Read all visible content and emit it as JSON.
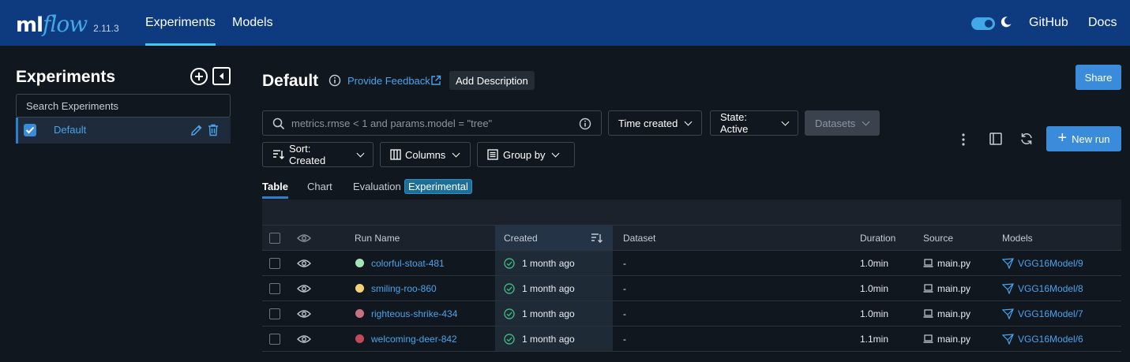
{
  "nav": {
    "logo_ml": "ml",
    "logo_flow": "flow",
    "version": "2.11.3",
    "items": [
      {
        "label": "Experiments",
        "active": true
      },
      {
        "label": "Models",
        "active": false
      }
    ],
    "github": "GitHub",
    "docs": "Docs"
  },
  "sidebar": {
    "title": "Experiments",
    "search_placeholder": "Search Experiments",
    "experiments": [
      {
        "name": "Default",
        "checked": true
      }
    ]
  },
  "header": {
    "title": "Default",
    "feedback_label": "Provide Feedback",
    "add_description_label": "Add Description",
    "share_label": "Share"
  },
  "filters": {
    "search_placeholder": "metrics.rmse < 1 and params.model = \"tree\"",
    "time_created": "Time created",
    "state": "State: Active",
    "datasets": "Datasets",
    "sort": "Sort: Created",
    "columns": "Columns",
    "group_by": "Group by",
    "new_run": "New run"
  },
  "tabs": [
    {
      "label": "Table",
      "active": true
    },
    {
      "label": "Chart",
      "active": false
    },
    {
      "label": "Evaluation",
      "active": false,
      "tag": "Experimental"
    }
  ],
  "table": {
    "headers": {
      "run_name": "Run Name",
      "created": "Created",
      "dataset": "Dataset",
      "duration": "Duration",
      "source": "Source",
      "models": "Models"
    },
    "rows": [
      {
        "run_name": "colorful-stoat-481",
        "color": "#a6e3b8",
        "created": "1 month ago",
        "dataset": "-",
        "duration": "1.0min",
        "source": "main.py",
        "model": "VGG16Model/9"
      },
      {
        "run_name": "smiling-roo-860",
        "color": "#f5d27a",
        "created": "1 month ago",
        "dataset": "-",
        "duration": "1.0min",
        "source": "main.py",
        "model": "VGG16Model/8"
      },
      {
        "run_name": "righteous-shrike-434",
        "color": "#c9727f",
        "created": "1 month ago",
        "dataset": "-",
        "duration": "1.0min",
        "source": "main.py",
        "model": "VGG16Model/7"
      },
      {
        "run_name": "welcoming-deer-842",
        "color": "#c14a5a",
        "created": "1 month ago",
        "dataset": "-",
        "duration": "1.1min",
        "source": "main.py",
        "model": "VGG16Model/6"
      }
    ]
  },
  "colors": {
    "topbar": "#0e3b80",
    "accent": "#3a8bd9",
    "link": "#4aa3ec",
    "success": "#3fb27f"
  }
}
